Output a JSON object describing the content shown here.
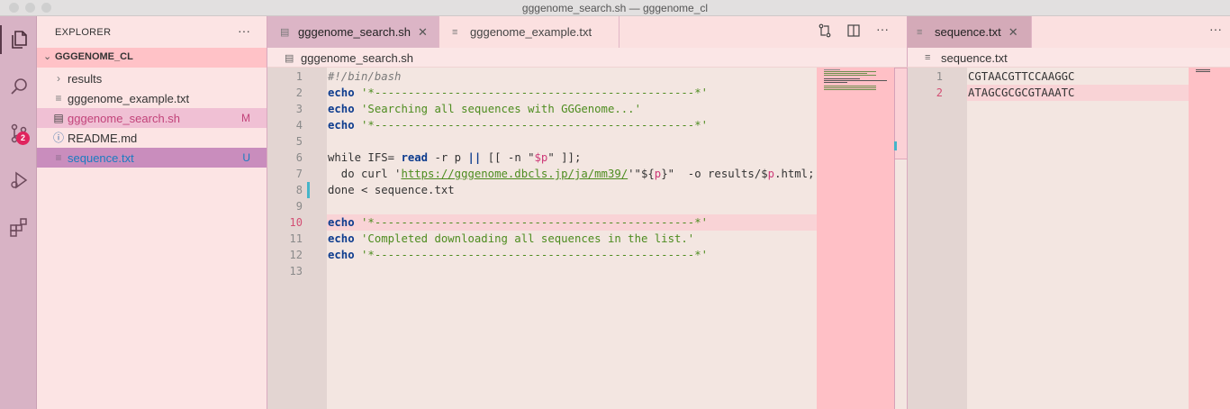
{
  "window": {
    "title": "gggenome_search.sh — gggenome_cl"
  },
  "activity_bar": {
    "scm_badge": "2"
  },
  "explorer": {
    "title": "EXPLORER",
    "more": "···",
    "folder": "GGGENOME_CL",
    "items": [
      {
        "icon": "chevron-right-icon",
        "label": "results",
        "status": ""
      },
      {
        "icon": "text-file-icon",
        "label": "gggenome_example.txt",
        "status": ""
      },
      {
        "icon": "shell-file-icon",
        "label": "gggenome_search.sh",
        "status": "M"
      },
      {
        "icon": "info-icon",
        "label": "README.md",
        "status": ""
      },
      {
        "icon": "text-file-icon",
        "label": "sequence.txt",
        "status": "U"
      }
    ]
  },
  "editor_left": {
    "tabs": [
      {
        "label": "gggenome_search.sh",
        "close": "✕",
        "active": true
      },
      {
        "label": "gggenome_example.txt",
        "active": false
      }
    ],
    "actions": {
      "more": "···"
    },
    "breadcrumb": "gggenome_search.sh",
    "line_numbers": [
      "1",
      "2",
      "3",
      "4",
      "5",
      "6",
      "7",
      "8",
      "9",
      "10",
      "11",
      "12",
      "13"
    ],
    "current_line": "10",
    "lines": {
      "l1": "#!/bin/bash",
      "l2": {
        "kw": "echo",
        "str": "'*------------------------------------------------*'"
      },
      "l3": {
        "kw": "echo",
        "str": "'Searching all sequences with GGGenome...'"
      },
      "l4": {
        "kw": "echo",
        "str": "'*------------------------------------------------*'"
      },
      "l6": {
        "a": "while IFS= ",
        "kw": "read",
        "b": " -r p ",
        "kw2": "||",
        "c": " [[ -n \"",
        "var": "$p",
        "d": "\" ]];"
      },
      "l7": {
        "a": "  do curl '",
        "url": "https://gggenome.dbcls.jp/ja/mm39/",
        "b": "'\"${",
        "var": "p",
        "c": "}\"  -o results/$",
        "var2": "p",
        "d": ".html;"
      },
      "l8": "done < sequence.txt",
      "l10": {
        "kw": "echo",
        "str": "'*------------------------------------------------*'"
      },
      "l11": {
        "kw": "echo",
        "str": "'Completed downloading all sequences in the list.'"
      },
      "l12": {
        "kw": "echo",
        "str": "'*------------------------------------------------*'"
      }
    }
  },
  "editor_right": {
    "tab": {
      "label": "sequence.txt",
      "close": "✕"
    },
    "more": "···",
    "breadcrumb": "sequence.txt",
    "line_numbers": [
      "1",
      "2"
    ],
    "current_line": "2",
    "lines": [
      "CGTAACGTTCCAAGGC",
      "ATAGCGCGCGTAAATC"
    ]
  },
  "colors": {
    "activity_bar": "#d8b3c5",
    "sidebar": "#fce4e4",
    "editor_bg": "#f3e6e1",
    "minimap": "#ffc0c6",
    "keyword": "#0d3c8e",
    "string": "#4d8c1f",
    "variable": "#cd3a78",
    "badge": "#e0245e"
  }
}
